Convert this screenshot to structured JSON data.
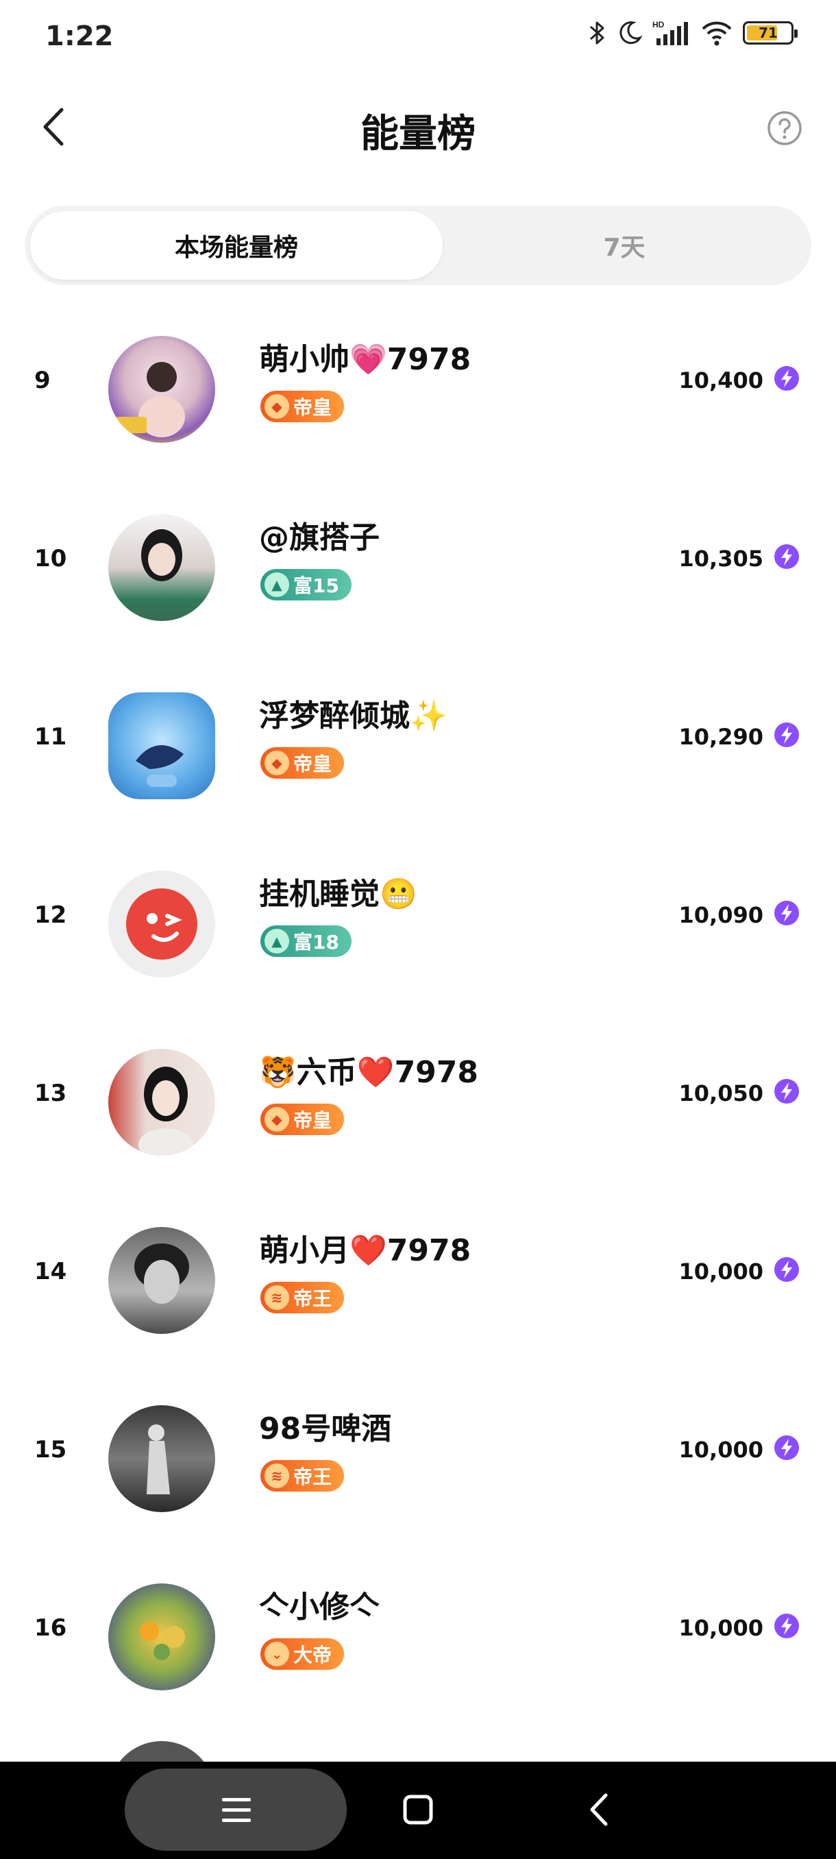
{
  "status_bar": {
    "time": "1:22",
    "battery_level": "71",
    "battery_fraction": 0.71
  },
  "nav": {
    "title": "能量榜"
  },
  "tabs": [
    {
      "label": "本场能量榜",
      "active": true
    },
    {
      "label": "7天",
      "active": false
    }
  ],
  "colors": {
    "badge_orange": "#f25a1a",
    "badge_teal": "#2c9b8a",
    "energy_purple": "#8a4dff",
    "battery_yellow": "#f2b82c"
  },
  "rankings": [
    {
      "rank": "9",
      "name": "萌小帅💗7978",
      "badge": "帝皇",
      "badge_style": "orange",
      "score": "10,400"
    },
    {
      "rank": "10",
      "name": "@旗搭子",
      "badge": "富15",
      "badge_style": "teal",
      "score": "10,305"
    },
    {
      "rank": "11",
      "name": "浮梦醉倾城✨",
      "badge": "帝皇",
      "badge_style": "orange",
      "score": "10,290"
    },
    {
      "rank": "12",
      "name": "挂机睡觉😬",
      "badge": "富18",
      "badge_style": "teal",
      "score": "10,090"
    },
    {
      "rank": "13",
      "name": "🐯六币❤️7978",
      "badge": "帝皇",
      "badge_style": "orange",
      "score": "10,050"
    },
    {
      "rank": "14",
      "name": "萌小月❤️7978",
      "badge": "帝王",
      "badge_style": "orange",
      "score": "10,000"
    },
    {
      "rank": "15",
      "name": "98号啤酒",
      "badge": "帝王",
      "badge_style": "orange",
      "score": "10,000"
    },
    {
      "rank": "16",
      "name": "亽小修亽",
      "badge": "大帝",
      "badge_style": "orange",
      "score": "10,000"
    }
  ]
}
